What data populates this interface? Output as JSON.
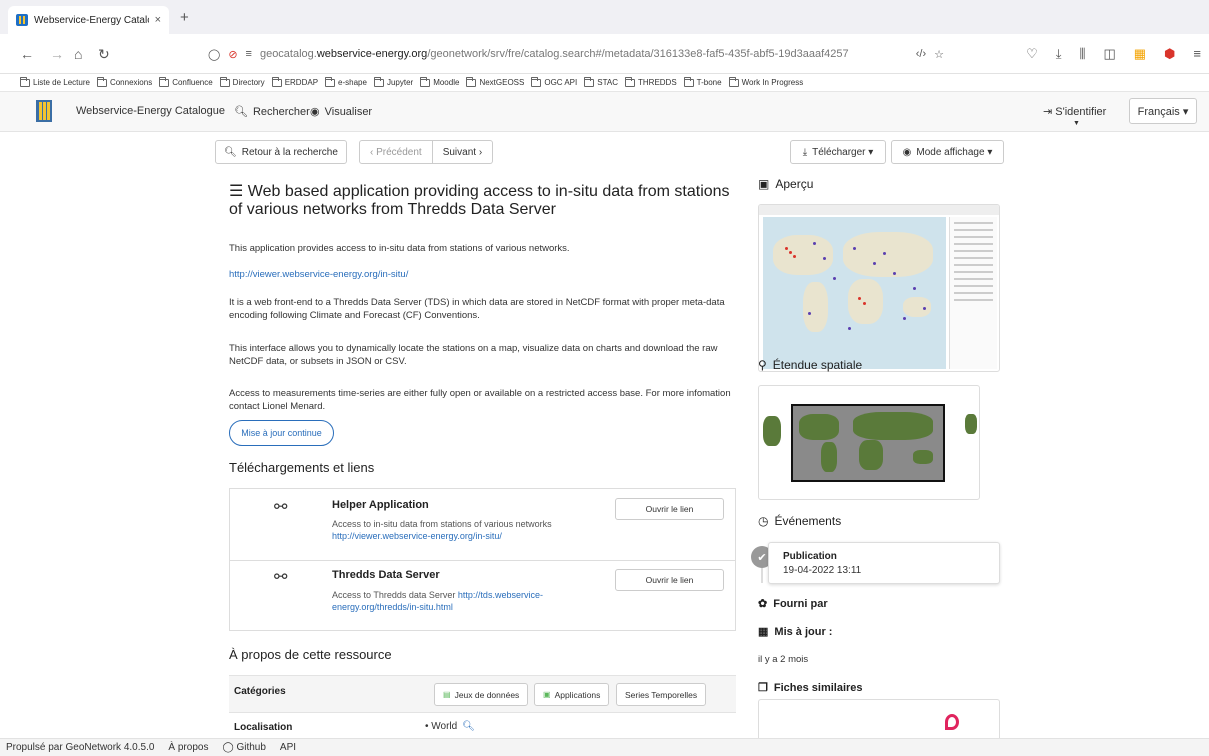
{
  "browser": {
    "tab_title": "Webservice-Energy Catalogue",
    "tab_close": "×",
    "new_tab": "+",
    "url_prefix": "geocatalog.",
    "url_domain": "webservice-energy.org",
    "url_path": "/geonetwork/srv/fre/catalog.search#/metadata/316133e8-faf5-435f-abf5-19d3aaaf4257",
    "bookmarks": [
      "Liste de Lecture",
      "Connexions",
      "Confluence",
      "Directory",
      "ERDDAP",
      "e-shape",
      "Jupyter",
      "Moodle",
      "NextGEOSS",
      "OGC API",
      "STAC",
      "THREDDS",
      "T-bone",
      "Work In Progress"
    ]
  },
  "header": {
    "app_title": "Webservice-Energy Catalogue",
    "search": "Rechercher",
    "visualize": "Visualiser",
    "login": "S'identifier",
    "language": "Français ▾"
  },
  "toolbar": {
    "back": "Retour à la recherche",
    "previous": "‹  Précédent",
    "next": "Suivant  ›",
    "download": "Télécharger ▾",
    "display_mode": "Mode affichage ▾"
  },
  "record": {
    "title": "Web based application providing access to in-situ data from stations of various networks from Thredds Data Server",
    "p1": "This application provides access to in-situ data from stations of various networks.",
    "p2_link": "http://viewer.webservice-energy.org/in-situ/",
    "p3": "It is a web front-end to a Thredds Data Server (TDS) in which data are stored in NetCDF format with proper meta-data encoding following Climate and Forecast (CF) Conventions.",
    "p4": "This interface allows you to dynamically locate the stations on a map, visualize data on charts and download the raw NetCDF data, or subsets in JSON or CSV.",
    "p5": "Access to measurements time-series are either fully open or available on a restricted access base. For more infomation contact Lionel Menard.",
    "update_badge": "Mise à jour continue"
  },
  "downloads": {
    "heading": "Téléchargements et liens",
    "items": [
      {
        "title": "Helper Application",
        "desc": "Access to in-situ data from stations of various networks",
        "link": "http://viewer.webservice-energy.org/in-situ/",
        "button": "Ouvrir le lien"
      },
      {
        "title": "Thredds Data Server",
        "desc": "Access to Thredds data Server",
        "link": "http://tds.webservice-energy.org/thredds/in-situ.html",
        "button": "Ouvrir le lien"
      }
    ]
  },
  "about": {
    "heading": "À propos de cette ressource",
    "categories_label": "Catégories",
    "chips": [
      "Jeux de données",
      "Applications",
      "Series Temporelles"
    ],
    "location_label": "Localisation",
    "location_value": "• World"
  },
  "sidebar": {
    "preview": "Aperçu",
    "extent": "Étendue spatiale",
    "events": "Événements",
    "event_title": "Publication",
    "event_date": "19-04-2022 13:11",
    "provided_by": "Fourni par",
    "updated": "Mis à jour :",
    "updated_value": "il y a 2 mois",
    "similar": "Fiches similaires"
  },
  "footer": {
    "powered": "Propulsé par GeoNetwork 4.0.5.0",
    "about": "À propos",
    "github": "Github",
    "api": "API"
  }
}
